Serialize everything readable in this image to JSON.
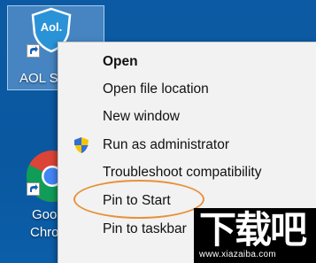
{
  "desktop": {
    "aol_icon": {
      "logo_text": "Aol.",
      "label": "AOL S"
    },
    "chrome_icon": {
      "label_line1": "Goo",
      "label_line2": "Chro"
    }
  },
  "context_menu": {
    "items": [
      {
        "label": "Open",
        "bold": true
      },
      {
        "label": "Open file location"
      },
      {
        "label": "New window"
      },
      {
        "label": "Run as administrator",
        "icon": "uac-shield-icon"
      },
      {
        "label": "Troubleshoot compatibility"
      },
      {
        "label": "Pin to Start",
        "highlighted": true
      },
      {
        "label": "Pin to taskbar"
      }
    ]
  },
  "annotation": {
    "highlight_color": "#e8913a"
  },
  "watermark": {
    "logo": "下载吧",
    "url": "www.xiazaiba.com"
  }
}
